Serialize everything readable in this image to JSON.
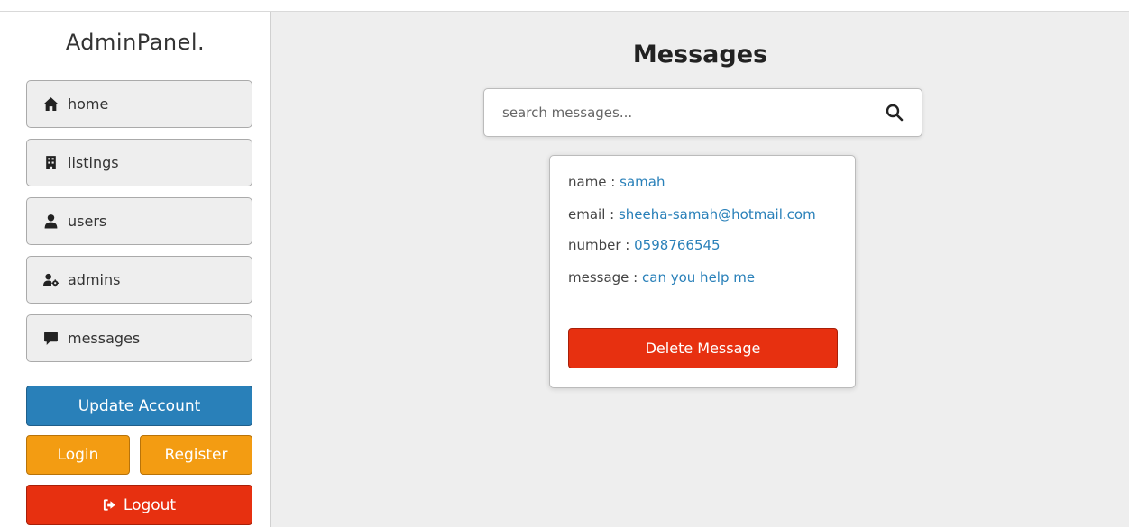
{
  "sidebar": {
    "brand": "AdminPanel.",
    "nav": [
      {
        "label": "home",
        "icon": "home-icon"
      },
      {
        "label": "listings",
        "icon": "building-icon"
      },
      {
        "label": "users",
        "icon": "user-icon"
      },
      {
        "label": "admins",
        "icon": "user-gear-icon"
      },
      {
        "label": "messages",
        "icon": "comment-icon"
      }
    ],
    "update_label": "Update Account",
    "login_label": "Login",
    "register_label": "Register",
    "logout_label": "Logout"
  },
  "main": {
    "title": "Messages",
    "search": {
      "placeholder": "search messages...",
      "value": ""
    },
    "message": {
      "name_label": "name : ",
      "name": "samah",
      "email_label": "email : ",
      "email": "sheeha-samah@hotmail.com",
      "number_label": "number : ",
      "number": "0598766545",
      "message_label": "message : ",
      "message": "can you help me",
      "delete_label": "Delete Message"
    }
  },
  "colors": {
    "primary": "#2980b9",
    "warning": "#f39c12",
    "danger": "#e73010",
    "background": "#eeeeee"
  }
}
